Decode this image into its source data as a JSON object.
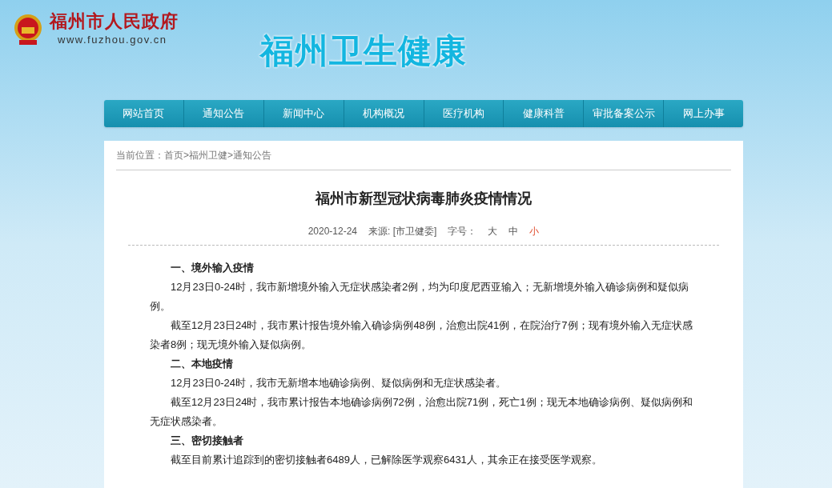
{
  "header": {
    "gov_name": "福州市人民政府",
    "gov_url": "www.fuzhou.gov.cn",
    "site_title": "福州卫生健康"
  },
  "nav": [
    "网站首页",
    "通知公告",
    "新闻中心",
    "机构概况",
    "医疗机构",
    "健康科普",
    "审批备案公示",
    "网上办事"
  ],
  "breadcrumb": "当前位置：首页>福州卫健>通知公告",
  "article": {
    "title": "福州市新型冠状病毒肺炎疫情情况",
    "date": "2020-12-24",
    "source": "来源: [市卫健委]",
    "font_size_label": "字号：",
    "font_sizes": [
      {
        "label": "大",
        "selected": false
      },
      {
        "label": "中",
        "selected": false
      },
      {
        "label": "小",
        "selected": true
      }
    ],
    "paragraphs": [
      {
        "kind": "heading",
        "text": "一、境外输入疫情"
      },
      {
        "kind": "text",
        "text": "12月23日0-24时，我市新增境外输入无症状感染者2例，均为印度尼西亚输入；无新增境外输入确诊病例和疑似病例。"
      },
      {
        "kind": "text",
        "text": "截至12月23日24时，我市累计报告境外输入确诊病例48例，治愈出院41例，在院治疗7例；现有境外输入无症状感染者8例；现无境外输入疑似病例。"
      },
      {
        "kind": "heading",
        "text": "二、本地疫情"
      },
      {
        "kind": "text",
        "text": "12月23日0-24时，我市无新增本地确诊病例、疑似病例和无症状感染者。"
      },
      {
        "kind": "text",
        "text": "截至12月23日24时，我市累计报告本地确诊病例72例，治愈出院71例，死亡1例；现无本地确诊病例、疑似病例和无症状感染者。"
      },
      {
        "kind": "heading",
        "text": "三、密切接触者"
      },
      {
        "kind": "text",
        "text": "截至目前累计追踪到的密切接触者6489人，已解除医学观察6431人，其余正在接受医学观察。"
      }
    ]
  }
}
